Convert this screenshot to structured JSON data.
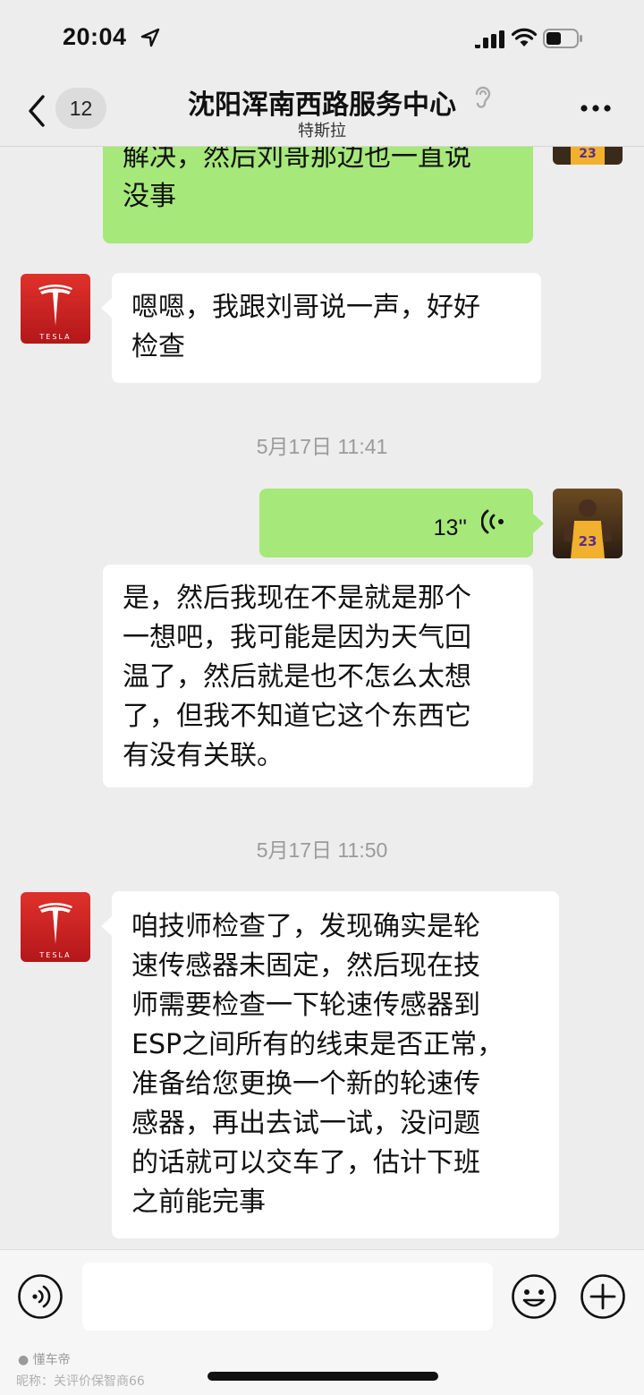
{
  "status_bar": {
    "time": "20:04"
  },
  "nav": {
    "unread_count": "12",
    "title": "沈阳浑南西路服务中心",
    "subtitle": "特斯拉"
  },
  "messages": [
    {
      "type": "text",
      "side": "right",
      "lines": [
        "解决，然后刘哥那边也一直说",
        "没事"
      ]
    },
    {
      "type": "text",
      "side": "left",
      "avatar": "tesla-logo",
      "lines": [
        "嗯嗯，我跟刘哥说一声，好好",
        "检查"
      ]
    },
    {
      "type": "time",
      "text": "5月17日 11:41"
    },
    {
      "type": "voice",
      "side": "right",
      "duration": "13''"
    },
    {
      "type": "transcript",
      "side": "right",
      "lines": [
        "是，然后我现在不是就是那个",
        "一想吧，我可能是因为天气回",
        "温了，然后就是也不怎么太想",
        "了，但我不知道它这个东西它",
        "有没有关联。"
      ]
    },
    {
      "type": "time",
      "text": "5月17日 11:50"
    },
    {
      "type": "text",
      "side": "left",
      "avatar": "tesla-logo",
      "lines": [
        "咱技师检查了，发现确实是轮",
        "速传感器未固定，然后现在技",
        "师需要检查一下轮速传感器到",
        "ESP之间所有的线束是否正常，",
        "准备给您更换一个新的轮速传",
        "感器，再出去试一试，没问题",
        "的话就可以交车了，估计下班",
        "之前能完事"
      ]
    }
  ],
  "avatar_labels": {
    "tesla": "TESLA"
  },
  "input_bar": {
    "placeholder": ""
  },
  "watermark": {
    "brand": "懂车帝",
    "nickname": "昵称：关评价保智商66"
  },
  "colors": {
    "outgoing_bubble": "#a6e87a",
    "incoming_bubble": "#ffffff",
    "background": "#ededed",
    "tesla_red": "#cc1f1f"
  }
}
